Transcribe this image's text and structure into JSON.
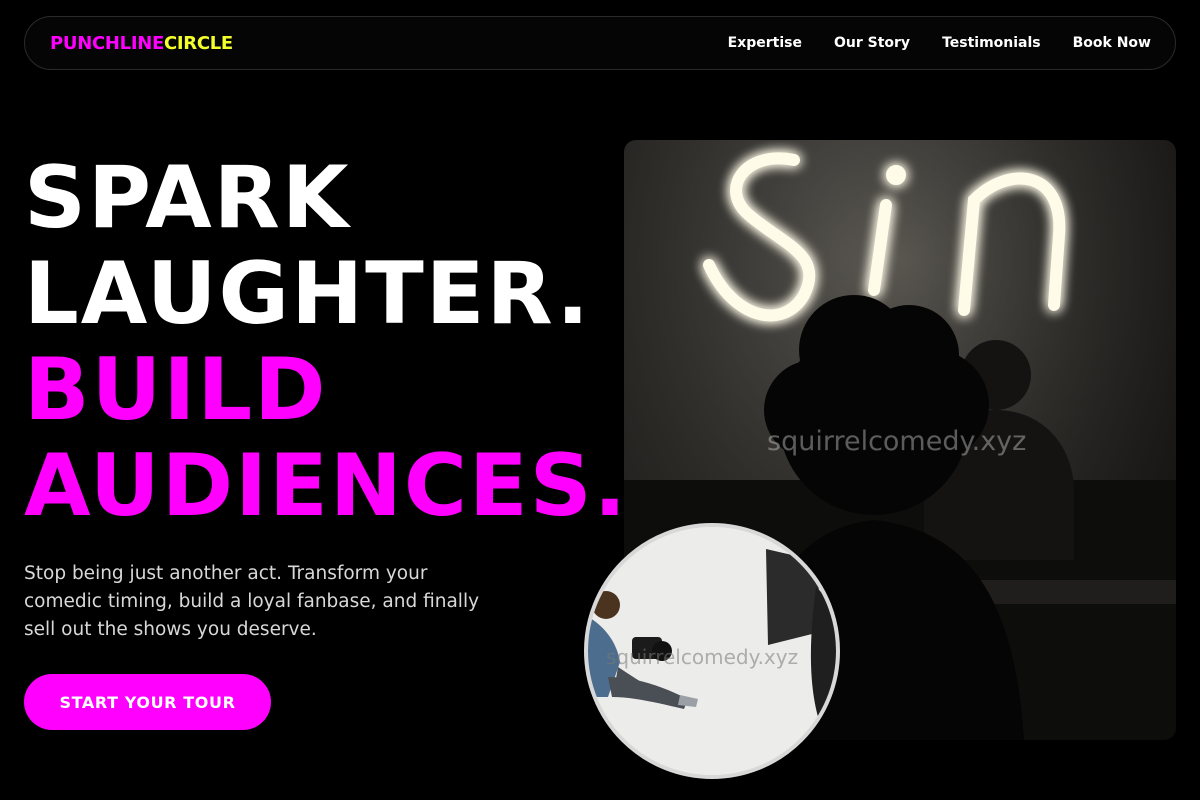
{
  "brand": {
    "part1": "PUNCHLINE",
    "part2": "CIRCLE",
    "colors": {
      "part1": "#ff00ff",
      "part2": "#f2ff2a"
    }
  },
  "nav": {
    "links": [
      {
        "label": "Expertise"
      },
      {
        "label": "Our Story"
      },
      {
        "label": "Testimonials"
      },
      {
        "label": "Book Now"
      }
    ]
  },
  "hero": {
    "headline": {
      "line1": "SPARK",
      "line2": "LAUGHTER.",
      "line3": "BUILD",
      "line4": "AUDIENCES."
    },
    "subtext": "Stop being just another act. Transform your comedic timing, build a loyal fanbase, and finally sell out the shows you deserve.",
    "cta_label": "START YOUR TOUR",
    "accent_color": "#ff00ff"
  },
  "images": {
    "main_watermark": "squirrelcomedy.xyz",
    "circle_watermark": "squirrelcomedy.xyz"
  }
}
